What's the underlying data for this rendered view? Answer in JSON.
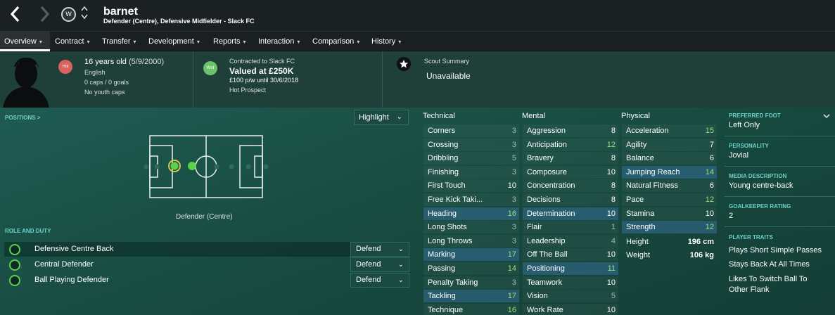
{
  "header": {
    "player_name": "barnet",
    "subtitle": "Defender (Centre), Defensive Midfielder - Slack FC",
    "back_icon": "chevron-left-icon",
    "forward_icon": "chevron-right-icon",
    "club_crest_text": "W"
  },
  "tabs": [
    {
      "label": "Overview"
    },
    {
      "label": "Contract"
    },
    {
      "label": "Transfer"
    },
    {
      "label": "Development"
    },
    {
      "label": "Reports"
    },
    {
      "label": "Interaction"
    },
    {
      "label": "Comparison"
    },
    {
      "label": "History"
    }
  ],
  "profile": {
    "nation_badge": "Hol",
    "age": "16 years old",
    "dob": "(5/9/2000)",
    "nationality": "English",
    "caps": "0 caps / 0 goals",
    "youth_caps": "No youth caps"
  },
  "contract": {
    "badge": "Wnt",
    "contracted_to": "Contracted to Slack FC",
    "value": "Valued at £250K",
    "wage": "£100 p/w until 30/6/2018",
    "status": "Hot Prospect"
  },
  "scout": {
    "label": "Scout Summary",
    "value": "Unavailable"
  },
  "positions": {
    "label": "POSITIONS >",
    "highlight_label": "Highlight",
    "position_name": "Defender (Centre)"
  },
  "roles": {
    "label": "ROLE AND DUTY",
    "items": [
      {
        "name": "Defensive Centre Back",
        "duty": "Defend"
      },
      {
        "name": "Central Defender",
        "duty": "Defend"
      },
      {
        "name": "Ball Playing Defender",
        "duty": "Defend"
      }
    ]
  },
  "attributes": {
    "technical": {
      "title": "Technical",
      "items": [
        {
          "name": "Corners",
          "value": "3"
        },
        {
          "name": "Crossing",
          "value": "3"
        },
        {
          "name": "Dribbling",
          "value": "5"
        },
        {
          "name": "Finishing",
          "value": "3"
        },
        {
          "name": "First Touch",
          "value": "10"
        },
        {
          "name": "Free Kick Taki...",
          "value": "3"
        },
        {
          "name": "Heading",
          "value": "16"
        },
        {
          "name": "Long Shots",
          "value": "3"
        },
        {
          "name": "Long Throws",
          "value": "3"
        },
        {
          "name": "Marking",
          "value": "17"
        },
        {
          "name": "Passing",
          "value": "14"
        },
        {
          "name": "Penalty Taking",
          "value": "3"
        },
        {
          "name": "Tackling",
          "value": "17"
        },
        {
          "name": "Technique",
          "value": "16"
        }
      ]
    },
    "mental": {
      "title": "Mental",
      "items": [
        {
          "name": "Aggression",
          "value": "8"
        },
        {
          "name": "Anticipation",
          "value": "12"
        },
        {
          "name": "Bravery",
          "value": "8"
        },
        {
          "name": "Composure",
          "value": "10"
        },
        {
          "name": "Concentration",
          "value": "8"
        },
        {
          "name": "Decisions",
          "value": "8"
        },
        {
          "name": "Determination",
          "value": "10"
        },
        {
          "name": "Flair",
          "value": "1"
        },
        {
          "name": "Leadership",
          "value": "4"
        },
        {
          "name": "Off The Ball",
          "value": "10"
        },
        {
          "name": "Positioning",
          "value": "11"
        },
        {
          "name": "Teamwork",
          "value": "10"
        },
        {
          "name": "Vision",
          "value": "5"
        },
        {
          "name": "Work Rate",
          "value": "10"
        }
      ]
    },
    "physical": {
      "title": "Physical",
      "items": [
        {
          "name": "Acceleration",
          "value": "15"
        },
        {
          "name": "Agility",
          "value": "7"
        },
        {
          "name": "Balance",
          "value": "6"
        },
        {
          "name": "Jumping Reach",
          "value": "14"
        },
        {
          "name": "Natural Fitness",
          "value": "6"
        },
        {
          "name": "Pace",
          "value": "12"
        },
        {
          "name": "Stamina",
          "value": "10"
        },
        {
          "name": "Strength",
          "value": "12"
        }
      ],
      "height_label": "Height",
      "height_value": "196 cm",
      "weight_label": "Weight",
      "weight_value": "106 kg"
    }
  },
  "side": {
    "preferred_foot_label": "PREFERRED FOOT",
    "preferred_foot": "Left Only",
    "personality_label": "PERSONALITY",
    "personality": "Jovial",
    "media_label": "MEDIA DESCRIPTION",
    "media": "Young centre-back",
    "gk_label": "GOALKEEPER RATING",
    "gk": "2",
    "traits_label": "PLAYER TRAITS",
    "traits": [
      "Plays Short Simple Passes",
      "Stays Back At All Times",
      "Likes To Switch Ball To",
      "Other Flank"
    ]
  },
  "colors": {
    "accent_teal": "#6ed0c8",
    "good_green": "#9ee07a",
    "position_green": "#5bd04d"
  }
}
